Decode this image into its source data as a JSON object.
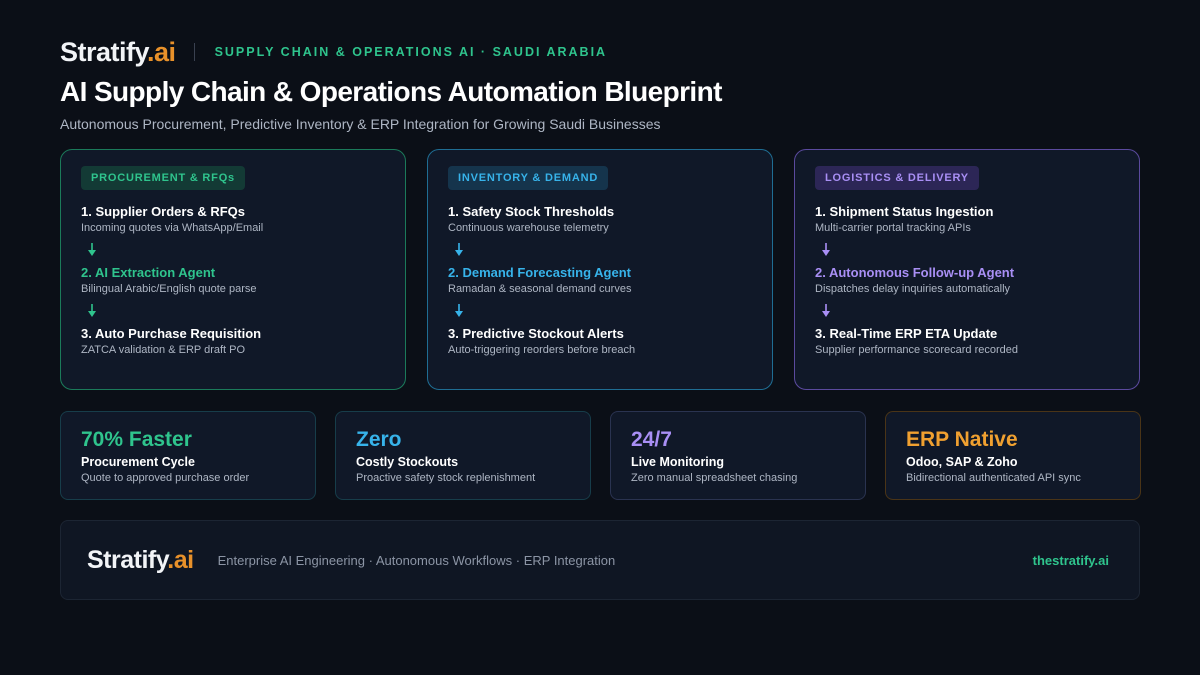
{
  "brand": {
    "name": "Stratify",
    "suffix": ".ai"
  },
  "header": {
    "tagline": "SUPPLY CHAIN & OPERATIONS AI · SAUDI ARABIA"
  },
  "title": "AI Supply Chain & Operations Automation Blueprint",
  "subtitle": "Autonomous Procurement, Predictive Inventory & ERP Integration for Growing Saudi Businesses",
  "colors": {
    "green": "#2fc48d",
    "blue": "#37b3ea",
    "purple": "#a98ff5",
    "orange": "#f0a030",
    "background": "#0b0f17"
  },
  "flows": [
    {
      "badge": "PROCUREMENT & RFQs",
      "steps": [
        {
          "title": "1. Supplier Orders & RFQs",
          "sub": "Incoming quotes via WhatsApp/Email"
        },
        {
          "title": "2. AI Extraction Agent",
          "sub": "Bilingual Arabic/English quote parse"
        },
        {
          "title": "3. Auto Purchase Requisition",
          "sub": "ZATCA validation & ERP draft PO"
        }
      ]
    },
    {
      "badge": "INVENTORY & DEMAND",
      "steps": [
        {
          "title": "1. Safety Stock Thresholds",
          "sub": "Continuous warehouse telemetry"
        },
        {
          "title": "2. Demand Forecasting Agent",
          "sub": "Ramadan & seasonal demand curves"
        },
        {
          "title": "3. Predictive Stockout Alerts",
          "sub": "Auto-triggering reorders before breach"
        }
      ]
    },
    {
      "badge": "LOGISTICS & DELIVERY",
      "steps": [
        {
          "title": "1. Shipment Status Ingestion",
          "sub": "Multi-carrier portal tracking APIs"
        },
        {
          "title": "2. Autonomous Follow-up Agent",
          "sub": "Dispatches delay inquiries automatically"
        },
        {
          "title": "3. Real-Time ERP ETA Update",
          "sub": "Supplier performance scorecard recorded"
        }
      ]
    }
  ],
  "stats": [
    {
      "value": "70% Faster",
      "label": "Procurement Cycle",
      "sub": "Quote to approved purchase order"
    },
    {
      "value": "Zero",
      "label": "Costly Stockouts",
      "sub": "Proactive safety stock replenishment"
    },
    {
      "value": "24/7",
      "label": "Live Monitoring",
      "sub": "Zero manual spreadsheet chasing"
    },
    {
      "value": "ERP Native",
      "label": "Odoo, SAP & Zoho",
      "sub": "Bidirectional authenticated API sync"
    }
  ],
  "footer": {
    "text": "Enterprise AI Engineering · Autonomous Workflows · ERP Integration",
    "link": "thestratify.ai"
  },
  "icons": {
    "arrow": "arrow-down-icon"
  }
}
